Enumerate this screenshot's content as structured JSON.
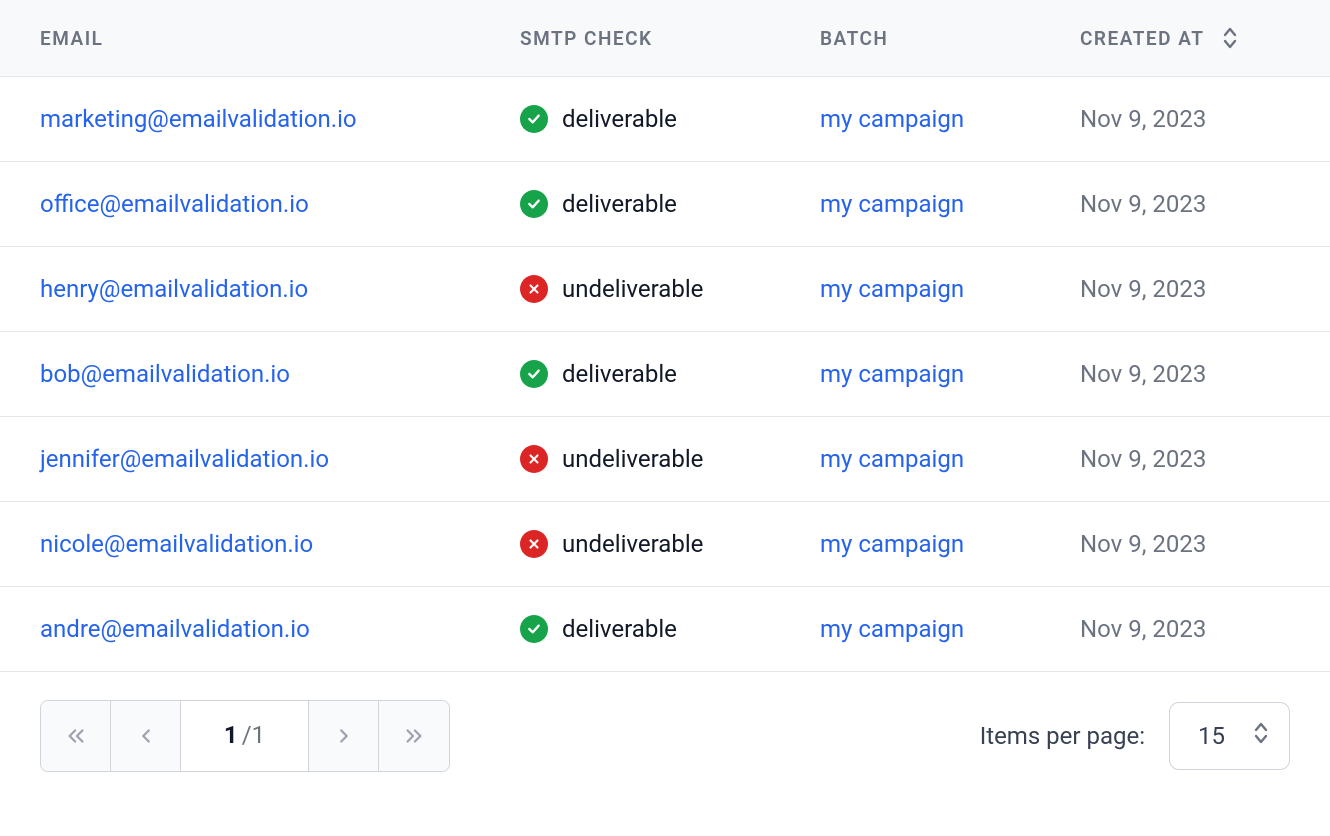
{
  "columns": {
    "email": "EMAIL",
    "smtp": "SMTP CHECK",
    "batch": "BATCH",
    "created": "CREATED AT"
  },
  "rows": [
    {
      "email": "marketing@emailvalidation.io",
      "smtp_status": "deliverable",
      "smtp_ok": true,
      "batch": "my campaign",
      "created": "Nov 9, 2023"
    },
    {
      "email": "office@emailvalidation.io",
      "smtp_status": "deliverable",
      "smtp_ok": true,
      "batch": "my campaign",
      "created": "Nov 9, 2023"
    },
    {
      "email": "henry@emailvalidation.io",
      "smtp_status": "undeliverable",
      "smtp_ok": false,
      "batch": "my campaign",
      "created": "Nov 9, 2023"
    },
    {
      "email": "bob@emailvalidation.io",
      "smtp_status": "deliverable",
      "smtp_ok": true,
      "batch": "my campaign",
      "created": "Nov 9, 2023"
    },
    {
      "email": "jennifer@emailvalidation.io",
      "smtp_status": "undeliverable",
      "smtp_ok": false,
      "batch": "my campaign",
      "created": "Nov 9, 2023"
    },
    {
      "email": "nicole@emailvalidation.io",
      "smtp_status": "undeliverable",
      "smtp_ok": false,
      "batch": "my campaign",
      "created": "Nov 9, 2023"
    },
    {
      "email": "andre@emailvalidation.io",
      "smtp_status": "deliverable",
      "smtp_ok": true,
      "batch": "my campaign",
      "created": "Nov 9, 2023"
    }
  ],
  "pagination": {
    "current": "1",
    "total_suffix": "/1",
    "items_per_page_label": "Items per page:",
    "items_per_page_value": "15"
  }
}
